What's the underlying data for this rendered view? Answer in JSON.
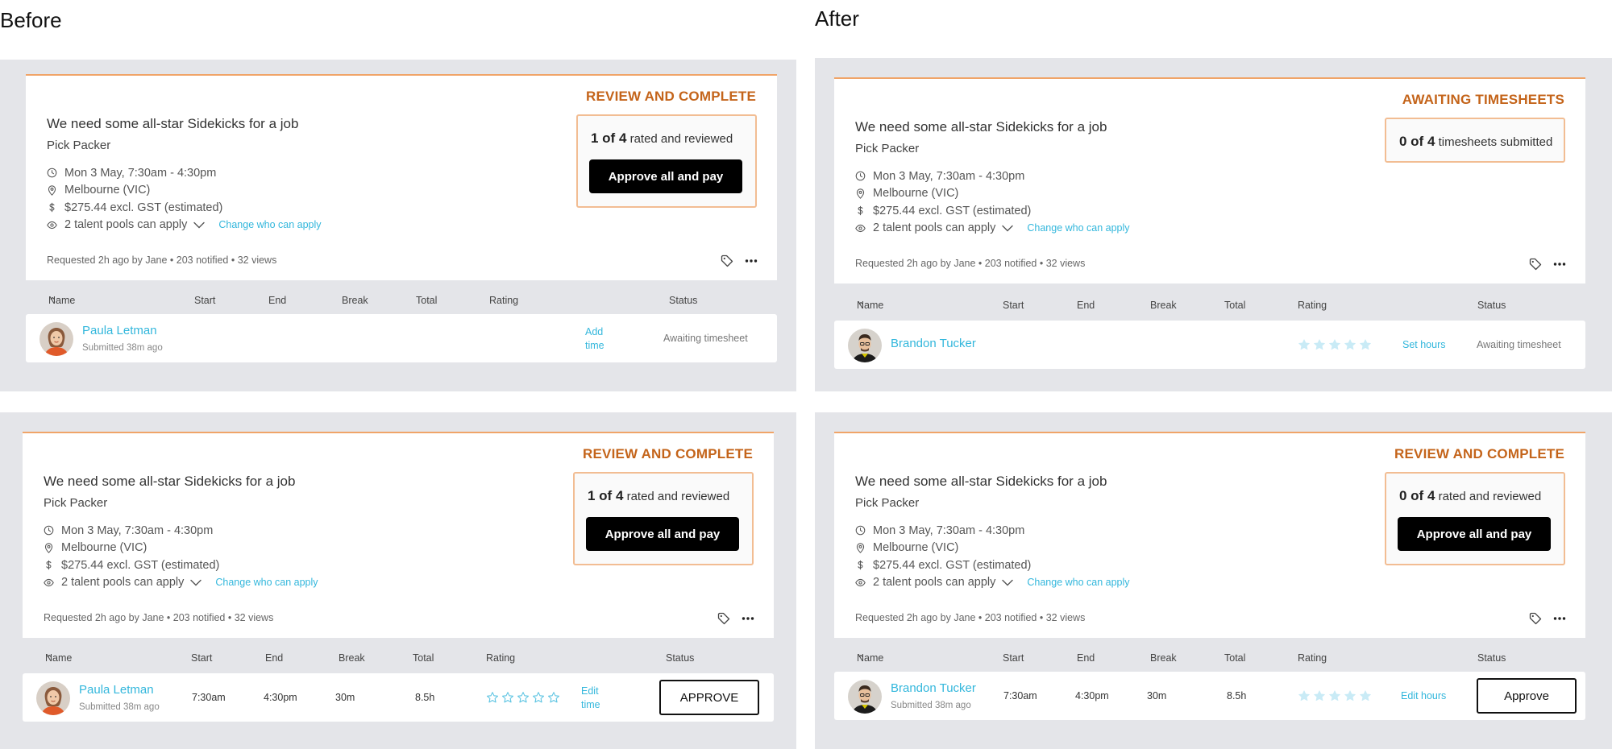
{
  "headings": {
    "before": "Before",
    "after": "After"
  },
  "colors": {
    "accent": "#c4641a",
    "link": "#33b7dc",
    "panel": "#e4e5e9",
    "border": "#f0a468"
  },
  "columns": {
    "name": "Name",
    "start": "Start",
    "end": "End",
    "break": "Break",
    "total": "Total",
    "rating": "Rating",
    "status": "Status"
  },
  "cards": [
    {
      "state": "REVIEW AND COMPLETE",
      "title": "We need some all-star Sidekicks for a job",
      "role": "Pick Packer",
      "datetime": "Mon 3 May, 7:30am - 4:30pm",
      "location": "Melbourne (VIC)",
      "pay": "$275.44 excl. GST (estimated)",
      "pools": "2 talent pools can apply",
      "change_link": "Change who can apply",
      "meta": "Requested 2h ago by Jane • 203 notified • 32 views",
      "summary_count": "1 of 4",
      "summary_text": "rated and reviewed",
      "primary_button": "Approve all and pay",
      "worker": {
        "name": "Paula Letman",
        "submitted": "Submitted 38m ago",
        "action_line1": "Add",
        "action_line2": "time",
        "status": "Awaiting timesheet"
      }
    },
    {
      "state": "REVIEW AND COMPLETE",
      "title": "We need some all-star Sidekicks for a job",
      "role": "Pick Packer",
      "datetime": "Mon 3 May, 7:30am - 4:30pm",
      "location": "Melbourne (VIC)",
      "pay": "$275.44 excl. GST (estimated)",
      "pools": "2 talent pools can apply",
      "change_link": "Change who can apply",
      "meta": "Requested 2h ago by Jane • 203 notified • 32 views",
      "summary_count": "1 of 4",
      "summary_text": "rated and reviewed",
      "primary_button": "Approve all and pay",
      "worker": {
        "name": "Paula Letman",
        "submitted": "Submitted 38m ago",
        "start": "7:30am",
        "end": "4:30pm",
        "break": "30m",
        "total": "8.5h",
        "action_line1": "Edit",
        "action_line2": "time",
        "status_button": "APPROVE"
      }
    },
    {
      "state": "AWAITING TIMESHEETS",
      "title": "We need some all-star Sidekicks for a job",
      "role": "Pick Packer",
      "datetime": "Mon 3 May, 7:30am - 4:30pm",
      "location": "Melbourne (VIC)",
      "pay": "$275.44 excl. GST (estimated)",
      "pools": "2 talent pools can apply",
      "change_link": "Change who can apply",
      "meta": "Requested 2h ago by Jane • 203 notified • 32 views",
      "summary_count": "0 of 4",
      "summary_text": "timesheets submitted",
      "worker": {
        "name": "Brandon Tucker",
        "action": "Set hours",
        "status": "Awaiting timesheet"
      }
    },
    {
      "state": "REVIEW AND COMPLETE",
      "title": "We need some all-star Sidekicks for a job",
      "role": "Pick Packer",
      "datetime": "Mon 3 May, 7:30am - 4:30pm",
      "location": "Melbourne (VIC)",
      "pay": "$275.44 excl. GST (estimated)",
      "pools": "2 talent pools can apply",
      "change_link": "Change who can apply",
      "meta": "Requested 2h ago by Jane • 203 notified • 32 views",
      "summary_count": "0 of 4",
      "summary_text": "rated and reviewed",
      "primary_button": "Approve all and pay",
      "worker": {
        "name": "Brandon Tucker",
        "submitted": "Submitted 38m ago",
        "start": "7:30am",
        "end": "4:30pm",
        "break": "30m",
        "total": "8.5h",
        "action": "Edit hours",
        "status_button": "Approve"
      }
    }
  ]
}
